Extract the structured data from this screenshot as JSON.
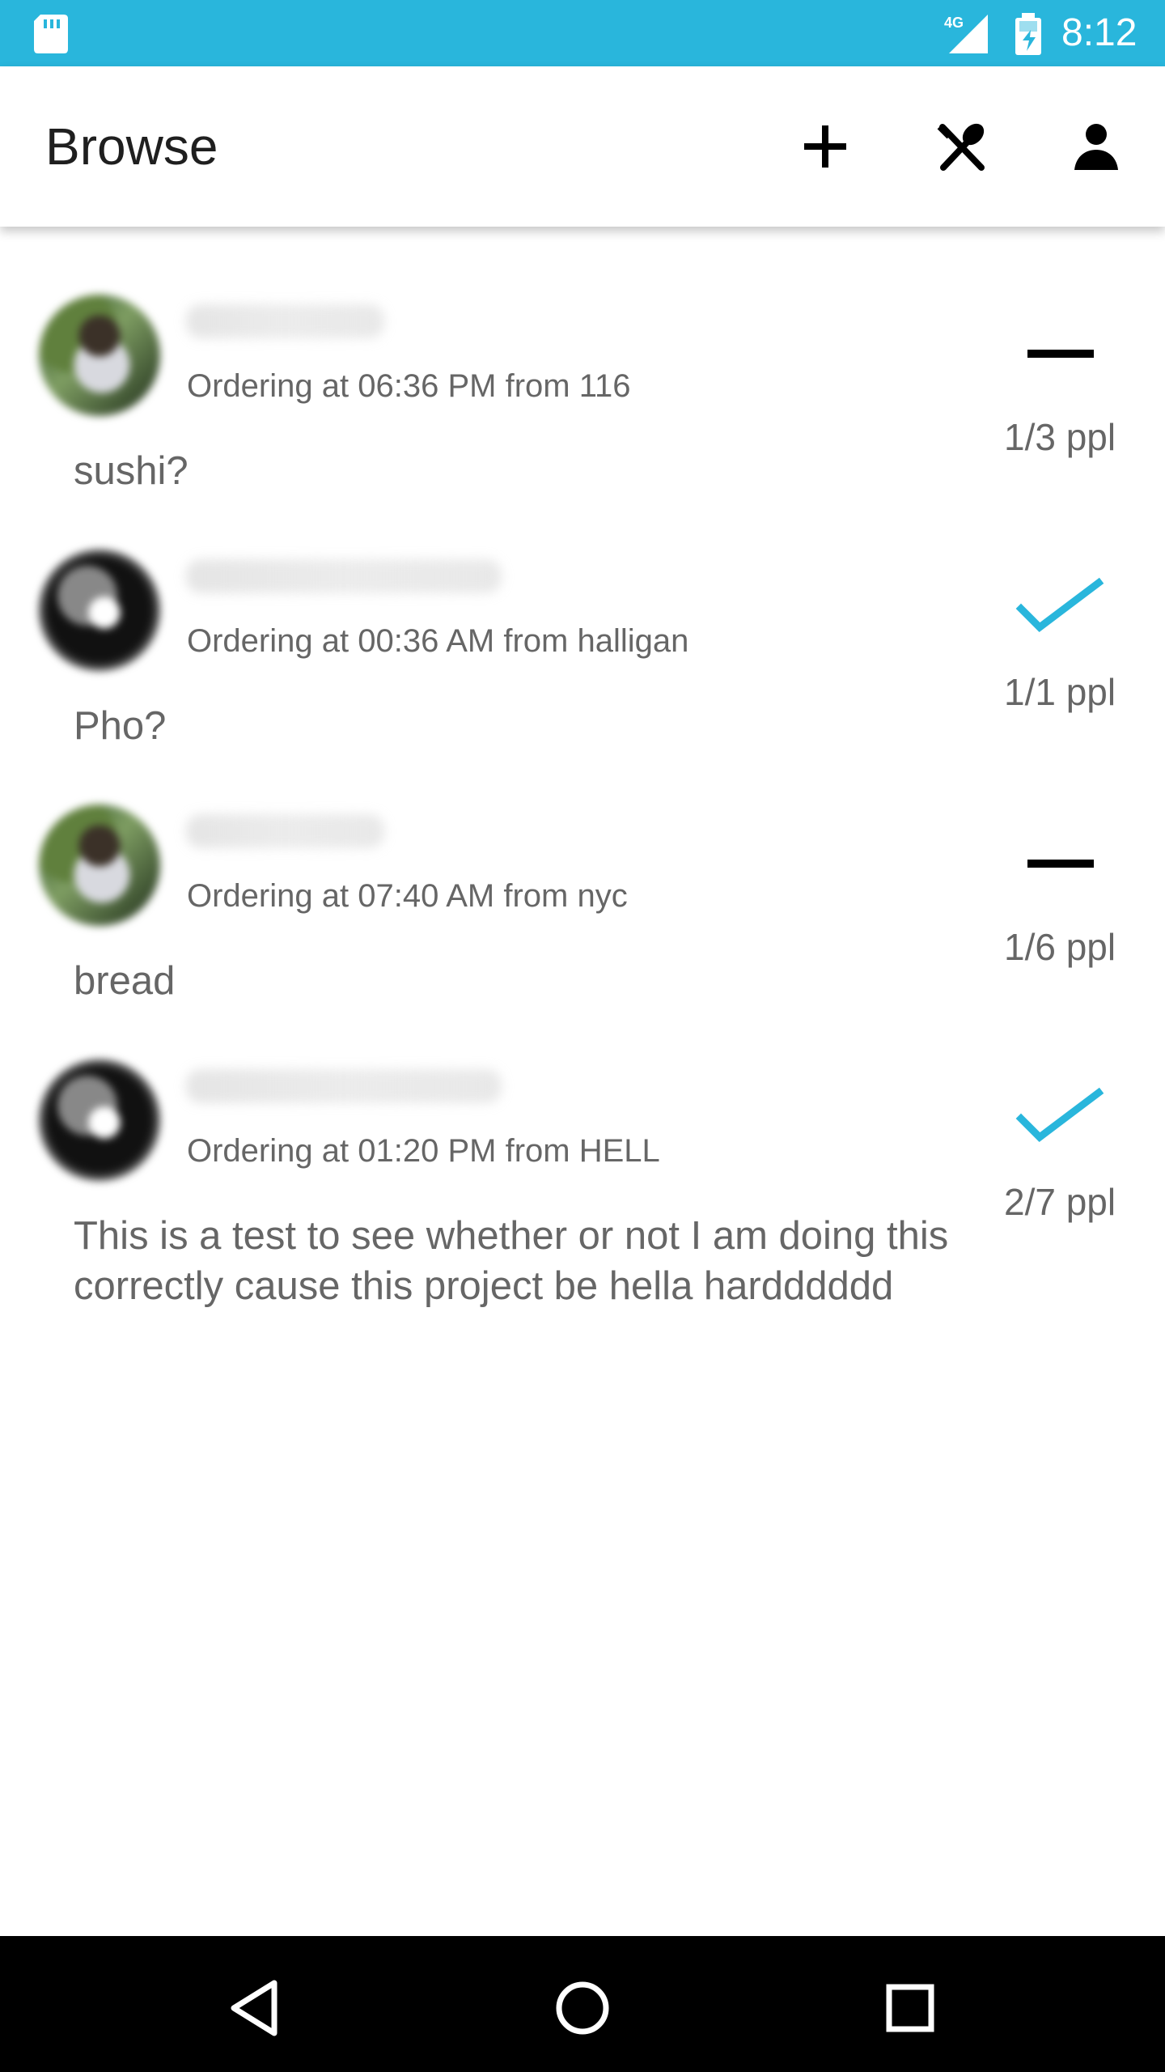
{
  "status_bar": {
    "network": "4G",
    "time": "8:12"
  },
  "app_bar": {
    "title": "Browse",
    "actions": [
      "add-icon",
      "food-icon",
      "profile-icon"
    ]
  },
  "feed": {
    "items": [
      {
        "order_prefix": "Ordering at",
        "order_time": "06:36 PM",
        "from_label": "from",
        "location": "116",
        "note": "sushi?",
        "ppl_count": "1/3 ppl",
        "status_icon": "minus-icon",
        "status_color": "#000000",
        "avatar_icon": "profile-photo-icon"
      },
      {
        "order_prefix": "Ordering at",
        "order_time": "00:36 AM",
        "from_label": "from",
        "location": "halligan",
        "note": "Pho?",
        "ppl_count": "1/1 ppl",
        "status_icon": "check-icon",
        "status_color": "#29b6dc",
        "avatar_icon": "profile-photo-icon"
      },
      {
        "order_prefix": "Ordering at",
        "order_time": "07:40 AM",
        "from_label": "from",
        "location": "nyc",
        "note": "bread",
        "ppl_count": "1/6 ppl",
        "status_icon": "minus-icon",
        "status_color": "#000000",
        "avatar_icon": "profile-photo-icon"
      },
      {
        "order_prefix": "Ordering at",
        "order_time": "01:20 PM",
        "from_label": "from",
        "location": "HELL",
        "note": "This is a test to see whether or not I am doing this correctly cause this project be hella hardddddd",
        "ppl_count": "2/7 ppl",
        "status_icon": "check-icon",
        "status_color": "#29b6dc",
        "avatar_icon": "profile-photo-icon"
      }
    ]
  },
  "colors": {
    "accent": "#29b6dc",
    "secondary_text": "#666666",
    "app_bar_text": "#1f1f1f",
    "navigation_bar": "#000000"
  },
  "navigation": {
    "buttons": [
      "back-icon",
      "home-icon",
      "recent-apps-icon"
    ]
  }
}
